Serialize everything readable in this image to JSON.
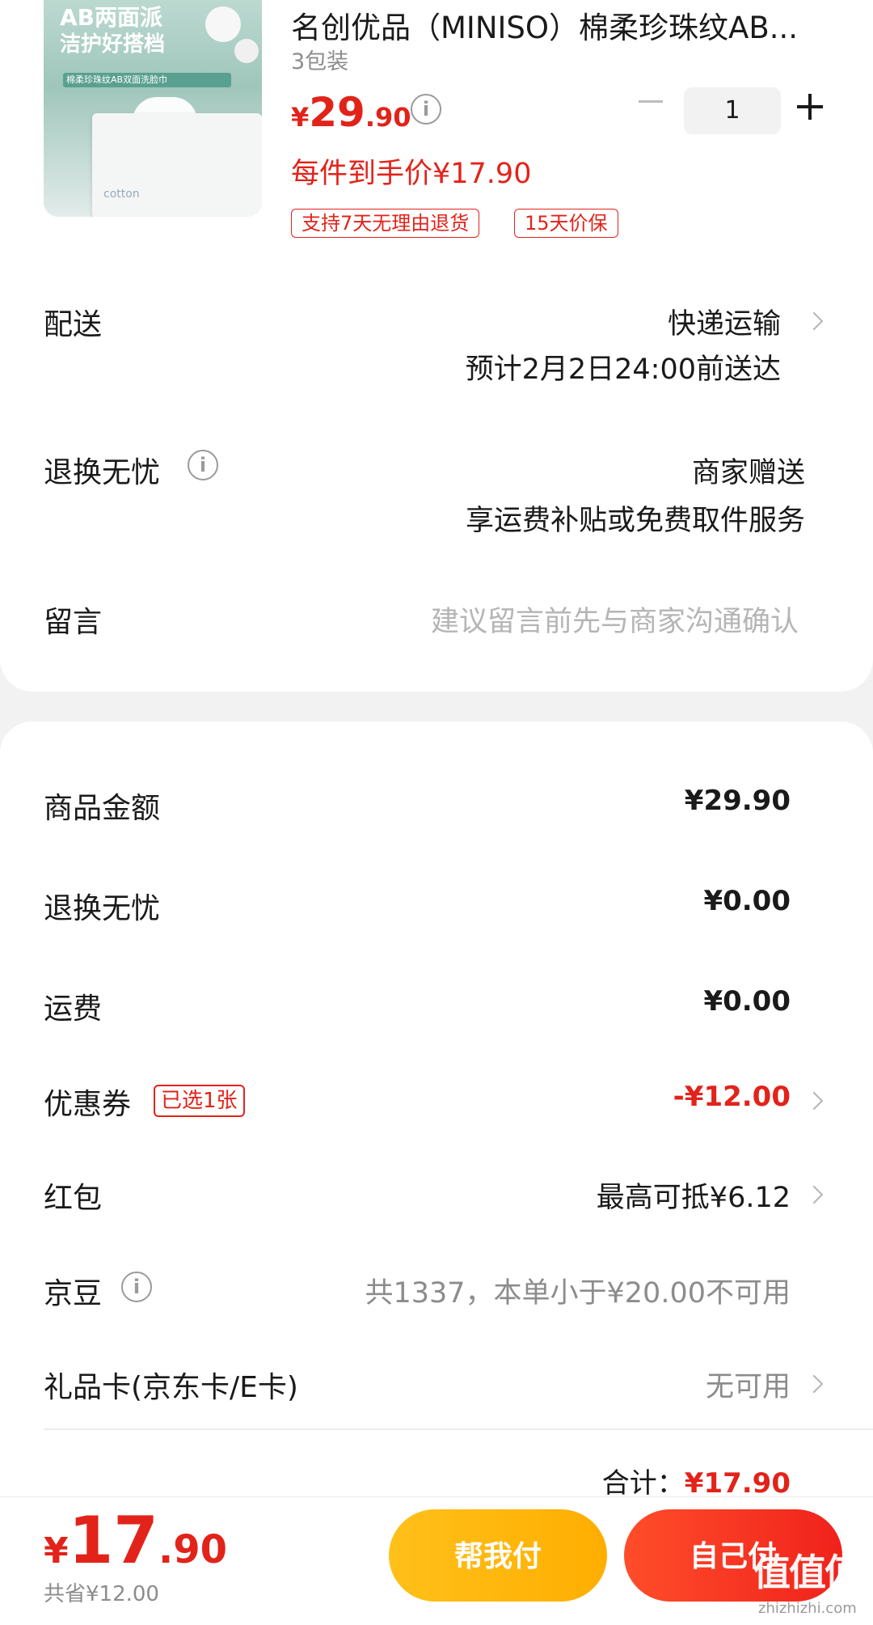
{
  "product": {
    "image_text_line1": "AB两面派",
    "image_text_line2": "洁护好搭档",
    "image_text_line3": "棉柔珍珠纹AB双面洗脸巾",
    "image_pack_text": "cotton",
    "title": "名创优品（MINISO）棉柔珍珠纹AB...",
    "spec": "3包装",
    "price_symbol": "¥",
    "price_int": "29",
    "price_dec": ".90",
    "info_glyph": "i",
    "quantity": "1",
    "final_price": "每件到手价¥17.90",
    "tags": [
      "支持7天无理由退货",
      "15天价保"
    ]
  },
  "delivery": {
    "label": "配送",
    "method": "快递运输",
    "eta": "预计2月2日24:00前送达"
  },
  "return_worry_free": {
    "label": "退换无忧",
    "value1": "商家赠送",
    "value2": "享运费补贴或免费取件服务"
  },
  "message": {
    "label": "留言",
    "placeholder": "建议留言前先与商家沟通确认"
  },
  "summary": {
    "goods_label": "商品金额",
    "goods_value": "¥29.90",
    "return_label": "退换无忧",
    "return_value": "¥0.00",
    "shipping_label": "运费",
    "shipping_value": "¥0.00",
    "coupon_label": "优惠券",
    "coupon_badge": "已选1张",
    "coupon_value": "-¥12.00",
    "redpacket_label": "红包",
    "redpacket_value": "最高可抵¥6.12",
    "jingdou_label": "京豆",
    "jingdou_value": "共1337，本单小于¥20.00不可用",
    "giftcard_label": "礼品卡(京东卡/E卡)",
    "giftcard_value": "无可用",
    "total_label": "合计：",
    "total_value": "¥17.90"
  },
  "bottom": {
    "price_symbol": "¥",
    "price_int": "17",
    "price_dec": ".90",
    "saved": "共省¥12.00",
    "friend_pay": "帮我付",
    "self_pay": "自己付"
  },
  "watermark": {
    "logo": "值值值",
    "site": "zhizhizhi.com"
  },
  "colors": {
    "accent_red": "#e2231a",
    "friend_btn": "#ffb400",
    "self_btn": "#f0221c"
  }
}
